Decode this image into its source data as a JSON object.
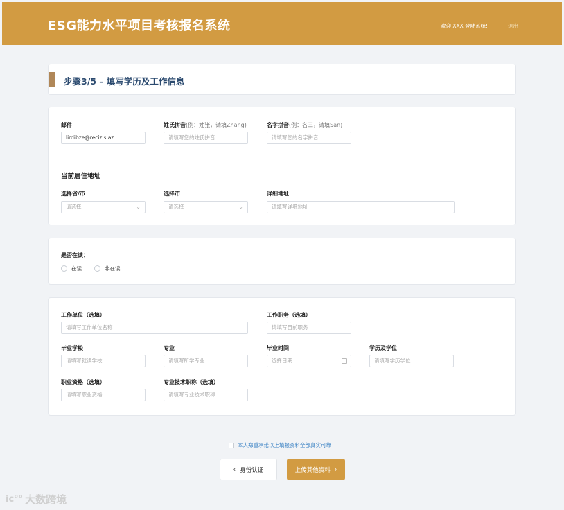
{
  "header": {
    "title": "ESG能力水平项目考核报名系统",
    "welcome": "欢迎 XXX 登陆系统!",
    "logout": "退出"
  },
  "step": {
    "text": "步骤3/5 – 填写学历及工作信息"
  },
  "contact": {
    "email_label": "邮件",
    "email_value": "lirdibze@recizis.az",
    "surname_label": "姓氏拼音",
    "surname_hint": "(例：姓张，请填Zhang)",
    "surname_placeholder": "请填写您的姓氏拼音",
    "givenname_label": "名字拼音",
    "givenname_hint": "(例：名三，请填San)",
    "givenname_placeholder": "请填写您的名字拼音"
  },
  "address": {
    "section_title": "当前居住地址",
    "province_label": "选择省/市",
    "province_placeholder": "请选择",
    "city_label": "选择市",
    "city_placeholder": "请选择",
    "detail_label": "详细地址",
    "detail_placeholder": "请填写详细地址"
  },
  "study": {
    "label": "是否在读：",
    "options": [
      "在读",
      "非在读"
    ]
  },
  "work": {
    "employer_label": "工作单位（选填）",
    "employer_placeholder": "请填写工作单位名称",
    "position_label": "工作职务（选填）",
    "position_placeholder": "请填写目前职务",
    "school_label": "毕业学校",
    "school_placeholder": "请填写就读学校",
    "major_label": "专业",
    "major_placeholder": "请填写所学专业",
    "gradtime_label": "毕业时间",
    "gradtime_placeholder": "选择日期",
    "degree_label": "学历及学位",
    "degree_placeholder": "请填写学历学位",
    "qualification_label": "职业资格（选填）",
    "qualification_placeholder": "请填写职业资格",
    "title_label": "专业技术职称（选填）",
    "title_placeholder": "请填写专业技术职称"
  },
  "footer": {
    "agree_text": "本人郑重承诺以上填报资料全部真实可靠",
    "prev_label": "身份认证",
    "next_label": "上传其他资料",
    "prev_icon": "‹",
    "next_icon": "›"
  },
  "watermark": {
    "text": "大数跨境",
    "logo": "ic°°"
  },
  "colors": {
    "brand": "#d29b42",
    "step_bar": "#b08758",
    "step_text": "#2b4a6f",
    "link": "#3b82c4"
  }
}
